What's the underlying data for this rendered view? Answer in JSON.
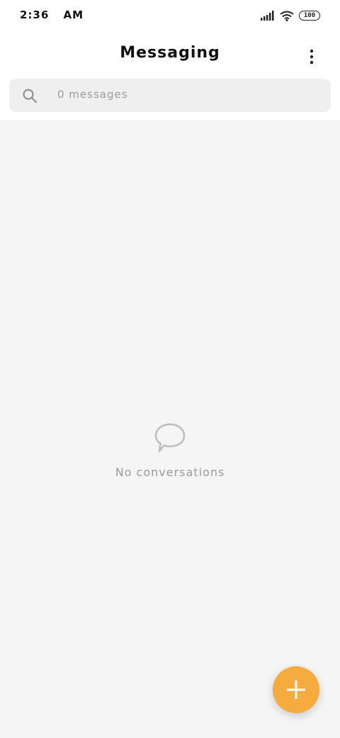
{
  "status_bar": {
    "time": "2:36",
    "period": "AM",
    "battery": "100",
    "icons": [
      "signal-icon",
      "wifi-icon",
      "battery-icon"
    ]
  },
  "header": {
    "title": "Messaging",
    "more_icon": "more-vertical-icon"
  },
  "search": {
    "placeholder": "0 messages"
  },
  "empty_state": {
    "icon": "chat-bubble-icon",
    "text": "No conversations"
  },
  "fab": {
    "icon": "plus-icon",
    "color": "#f5ab3d"
  },
  "colors": {
    "background": "#f5f5f5",
    "header": "#ffffff",
    "search_bg": "#efefef",
    "accent": "#f5ab3d",
    "muted_text": "#9a9a9a"
  }
}
